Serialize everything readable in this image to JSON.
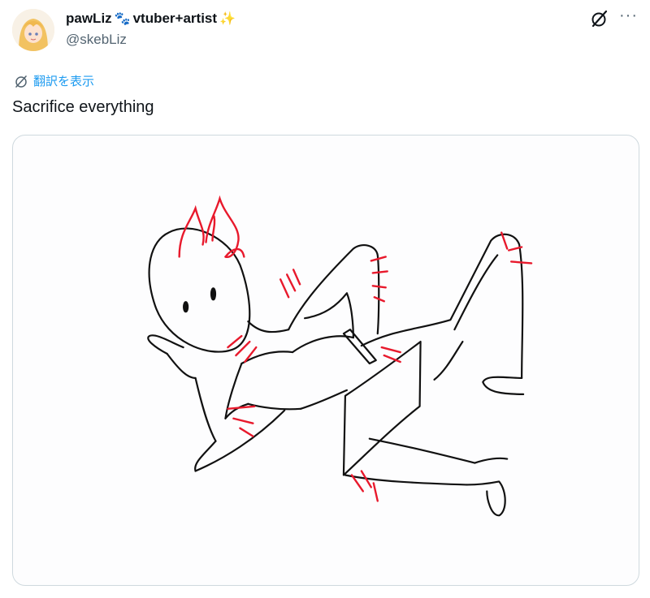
{
  "author": {
    "display_name": "pawLiz",
    "name_suffix": "vtuber+artist",
    "paw_emoji": "🐾",
    "sparkle_emoji": "✨",
    "handle": "@skebLiz"
  },
  "actions": {
    "grok_icon": "grok-icon",
    "more_label": "···"
  },
  "translate": {
    "label": "翻訳を表示",
    "color": "#1d9bf0"
  },
  "tweet": {
    "text": "Sacrifice everything"
  },
  "media": {
    "description_icon": "image",
    "stroke_color": "#111111",
    "accent_color": "#e8192c"
  }
}
